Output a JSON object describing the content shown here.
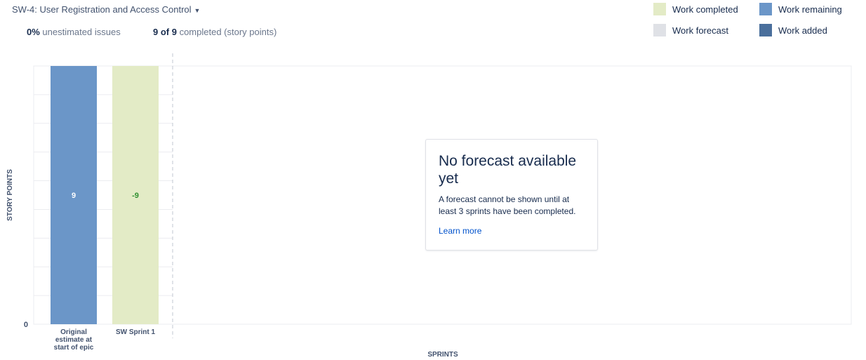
{
  "header": {
    "epic_label": "SW-4: User Registration and Access Control",
    "stats": [
      {
        "value": "0%",
        "text": " unestimated issues"
      },
      {
        "value": "9 of 9",
        "text": " completed (story points)"
      }
    ]
  },
  "legend": [
    {
      "label": "Work completed",
      "color": "#e3ebc6"
    },
    {
      "label": "Work remaining",
      "color": "#6b96c8"
    },
    {
      "label": "Work forecast",
      "color": "#dfe1e6"
    },
    {
      "label": "Work added",
      "color": "#4a6f9c"
    }
  ],
  "forecast": {
    "title": "No forecast available yet",
    "text": "A forecast cannot be shown until at least 3 sprints have been completed.",
    "link": "Learn more"
  },
  "chart_data": {
    "type": "bar",
    "xlabel": "SPRINTS",
    "ylabel": "STORY POINTS",
    "y_tick_labels": [
      "0"
    ],
    "ylim": [
      0,
      9
    ],
    "grid": true,
    "categories": [
      [
        "Original",
        "estimate at",
        "start of epic"
      ],
      [
        "SW Sprint 1"
      ]
    ],
    "bars": [
      {
        "category_index": 0,
        "series": "Work remaining",
        "value": 9,
        "label": "9",
        "color": "#6b96c8",
        "label_color": "#ffffff"
      },
      {
        "category_index": 1,
        "series": "Work completed",
        "value": 9,
        "label": "-9",
        "color": "#e3ebc6",
        "label_color": "#2f8f2f"
      }
    ]
  }
}
